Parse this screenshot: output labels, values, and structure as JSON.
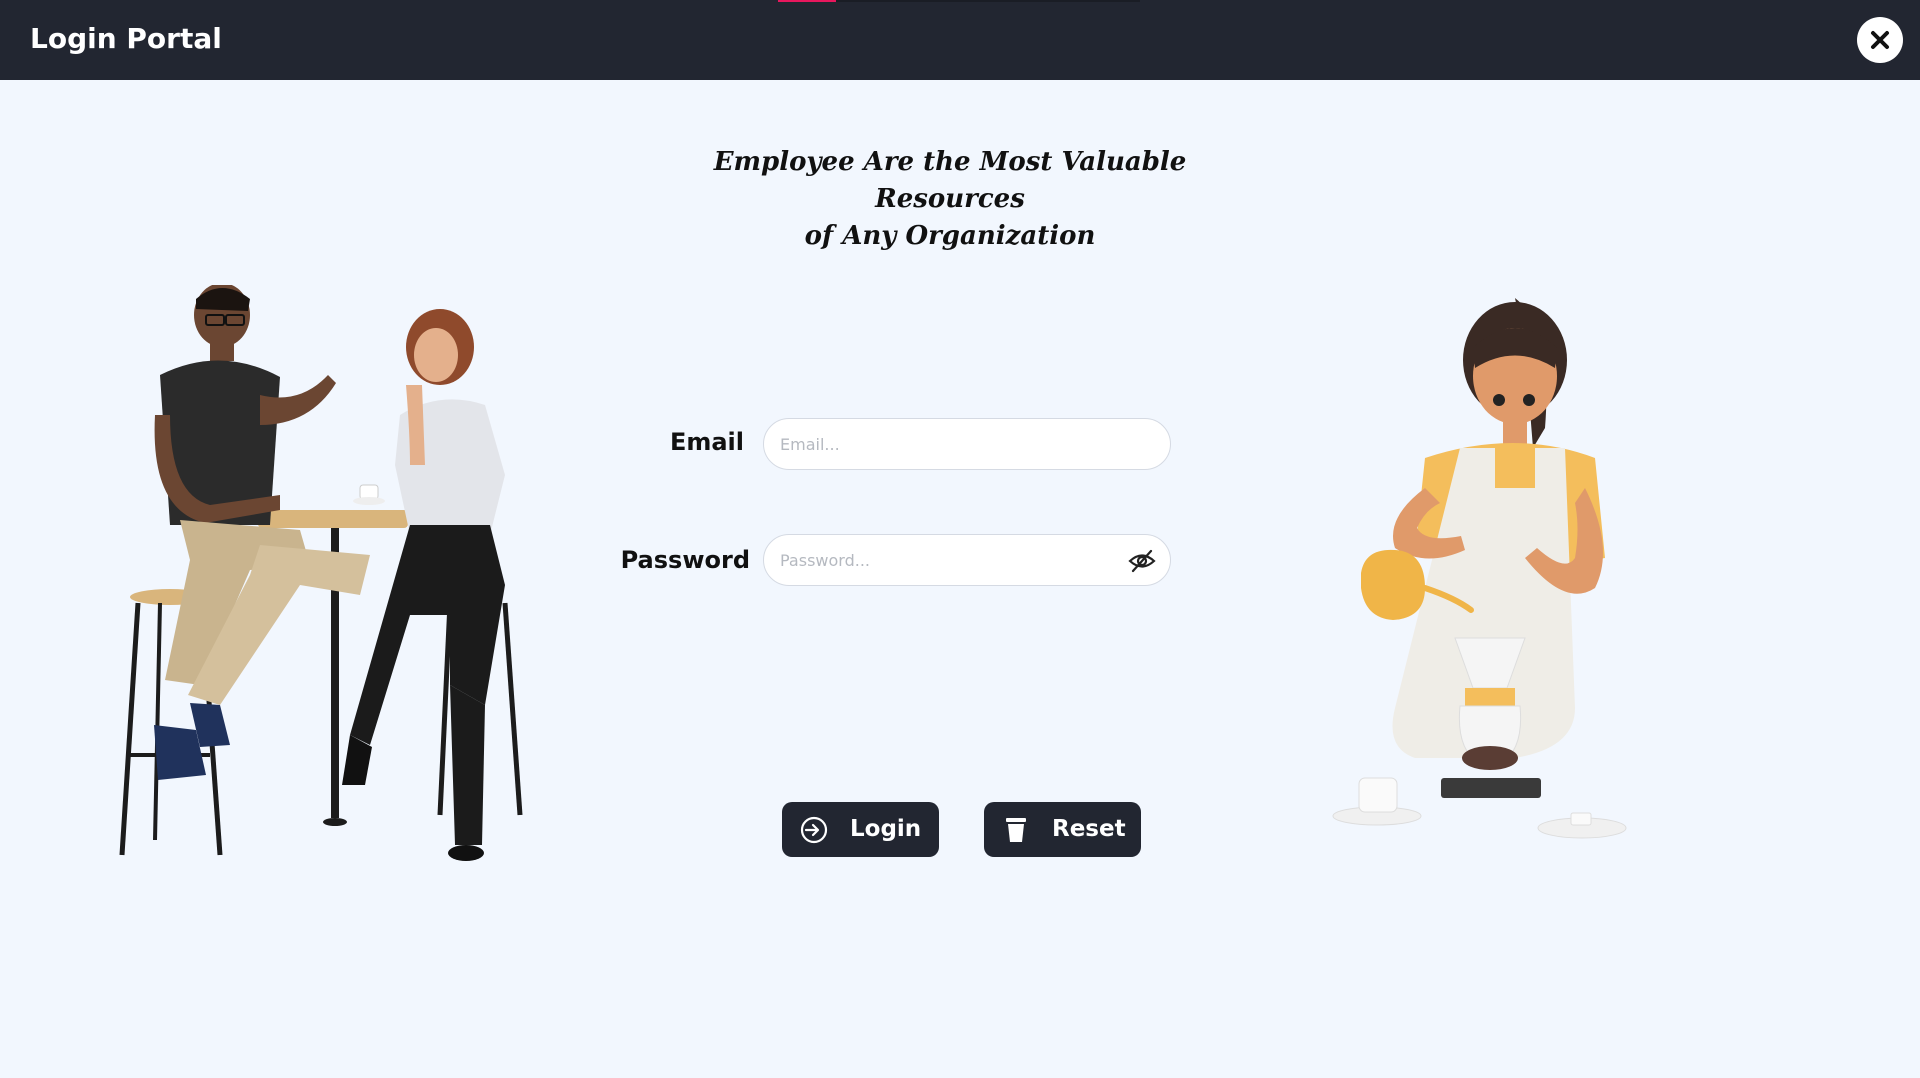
{
  "window": {
    "title": "Login Portal",
    "loading_progress": 0.16,
    "accent_color": "#e8175d",
    "header_color": "#222631"
  },
  "tagline": {
    "line1": "Employee Are the Most Valuable Resources",
    "line2": "of Any Organization"
  },
  "form": {
    "email_label": "Email",
    "email_placeholder": "Email...",
    "email_value": "",
    "password_label": "Password",
    "password_placeholder": "Password...",
    "password_value": "",
    "password_visibility_icon": "eye-off-icon"
  },
  "buttons": {
    "login_label": "Login",
    "login_icon": "login-icon",
    "reset_label": "Reset",
    "reset_icon": "trash-icon"
  },
  "illustrations": {
    "left": "people-at-cafe-table",
    "right": "woman-brewing-coffee"
  }
}
